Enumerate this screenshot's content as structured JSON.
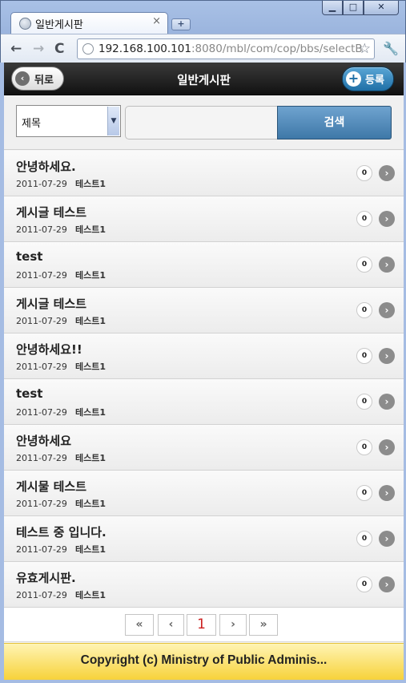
{
  "browser": {
    "tab_title": "일반게시판",
    "tab_close": "×",
    "new_tab": "+",
    "window_buttons": {
      "minimize": "▁",
      "maximize": "□",
      "close": "✕"
    },
    "nav": {
      "back": "←",
      "forward": "→",
      "reload": "C"
    },
    "url_host": "192.168.100.101",
    "url_rest": ":8080/mbl/com/cop/bbs/selectB",
    "star": "☆",
    "wrench": "🔧"
  },
  "header": {
    "back_label": "뒤로",
    "back_icon": "‹",
    "title": "일반게시판",
    "register_label": "등록",
    "register_icon": "+"
  },
  "search": {
    "select_value": "제목",
    "select_arrow": "▼",
    "input_value": "",
    "button_label": "검색"
  },
  "posts": [
    {
      "title": "안녕하세요.",
      "date": "2011-07-29",
      "author": "테스트1",
      "comments": "0"
    },
    {
      "title": "게시글 테스트",
      "date": "2011-07-29",
      "author": "테스트1",
      "comments": "0"
    },
    {
      "title": "test",
      "date": "2011-07-29",
      "author": "테스트1",
      "comments": "0"
    },
    {
      "title": "게시글 테스트",
      "date": "2011-07-29",
      "author": "테스트1",
      "comments": "0"
    },
    {
      "title": "안녕하세요!!",
      "date": "2011-07-29",
      "author": "테스트1",
      "comments": "0"
    },
    {
      "title": "test",
      "date": "2011-07-29",
      "author": "테스트1",
      "comments": "0"
    },
    {
      "title": "안녕하세요",
      "date": "2011-07-29",
      "author": "테스트1",
      "comments": "0"
    },
    {
      "title": "게시물 테스트",
      "date": "2011-07-29",
      "author": "테스트1",
      "comments": "0"
    },
    {
      "title": "테스트 중 입니다.",
      "date": "2011-07-29",
      "author": "테스트1",
      "comments": "0"
    },
    {
      "title": "유효게시판.",
      "date": "2011-07-29",
      "author": "테스트1",
      "comments": "0"
    }
  ],
  "row_chevron": "›",
  "pagination": {
    "first": "«",
    "prev": "‹",
    "current": "1",
    "next": "›",
    "last": "»"
  },
  "footer": {
    "text": "Copyright (c) Ministry of Public Adminis..."
  }
}
